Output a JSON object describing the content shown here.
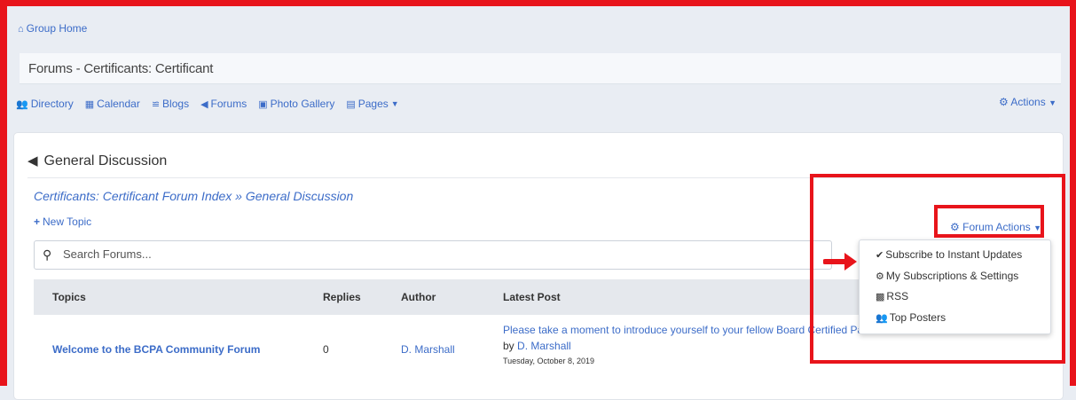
{
  "group_home": {
    "icon": "home-icon",
    "label": "Group Home"
  },
  "page_title": "Forums - Certificants: Certificant",
  "nav": {
    "items": [
      {
        "icon": "users-icon",
        "label": "Directory"
      },
      {
        "icon": "calendar-icon",
        "label": "Calendar"
      },
      {
        "icon": "rss-icon",
        "label": "Blogs"
      },
      {
        "icon": "megaphone-icon",
        "label": "Forums"
      },
      {
        "icon": "image-icon",
        "label": "Photo Gallery"
      },
      {
        "icon": "page-icon",
        "label": "Pages"
      }
    ],
    "actions_label": "Actions"
  },
  "forum": {
    "heading": "General Discussion",
    "breadcrumb": "Certificants: Certificant Forum Index » General Discussion",
    "new_topic": "New Topic",
    "search_placeholder": "Search Forums...",
    "forum_actions": "Forum Actions",
    "columns": [
      "Topics",
      "Replies",
      "Author",
      "Latest Post"
    ],
    "rows": [
      {
        "topic": "Welcome to the BCPA Community Forum",
        "replies": "0",
        "author": "D. Marshall",
        "latest_post": "Please take a moment to introduce yourself to your fellow Board Certified Patient Advocates.",
        "by_prefix": "by",
        "by_author": "D. Marshall",
        "date": "Tuesday, October 8, 2019"
      }
    ]
  },
  "dropdown": {
    "items": [
      {
        "icon": "check-circle-icon",
        "label": "Subscribe to Instant Updates"
      },
      {
        "icon": "gear-icon",
        "label": "My Subscriptions & Settings"
      },
      {
        "icon": "rss-square-icon",
        "label": "RSS"
      },
      {
        "icon": "users-icon",
        "label": "Top Posters"
      }
    ]
  },
  "colors": {
    "accent": "#3c6cc8",
    "highlight": "#e8141b"
  }
}
